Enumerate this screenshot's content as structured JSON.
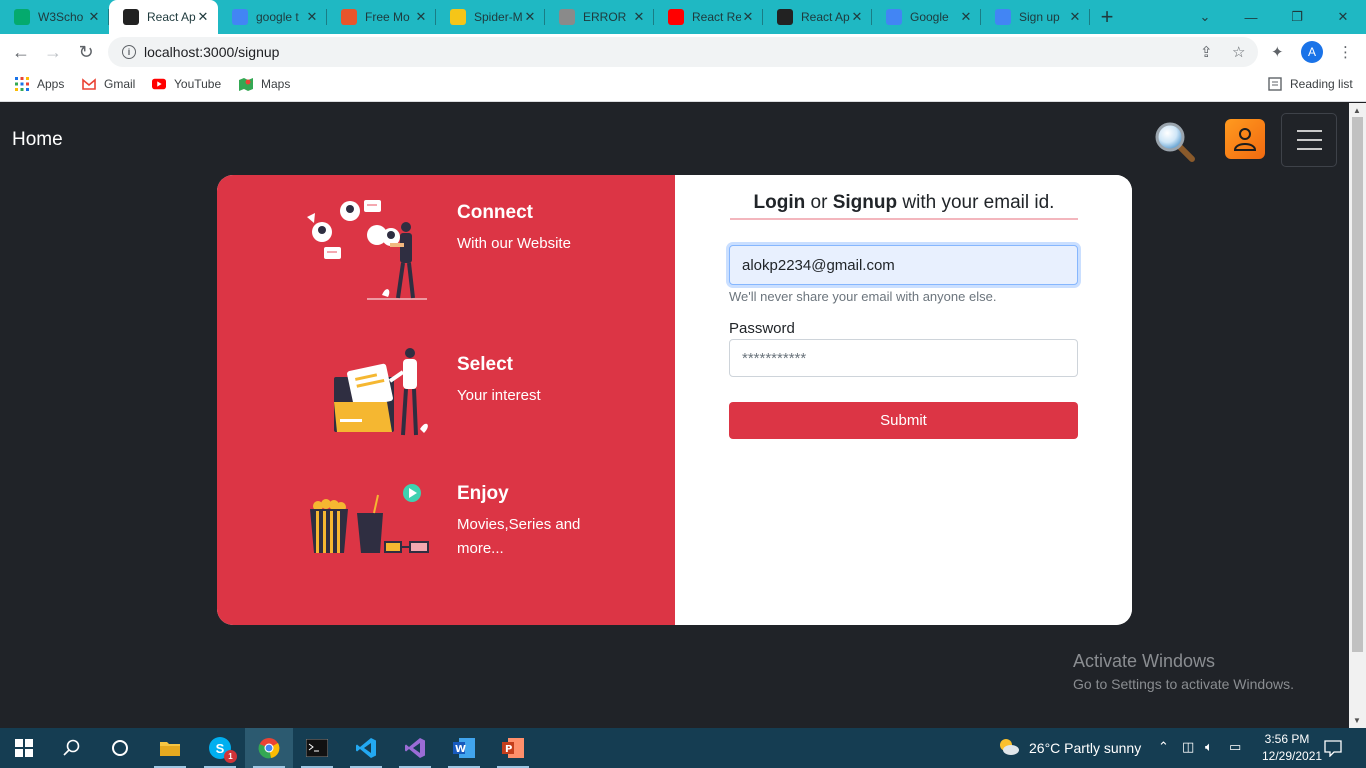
{
  "browser": {
    "tabs": [
      {
        "title": "W3Scho",
        "favicon": "w3schools-icon",
        "color": "#04aa6d"
      },
      {
        "title": "React Ap",
        "favicon": "react-icon",
        "color": "#222222",
        "active": true
      },
      {
        "title": "google t",
        "favicon": "google-icon",
        "color": "#4285f4"
      },
      {
        "title": "Free Mo",
        "favicon": "ae-icon",
        "color": "#e8552b"
      },
      {
        "title": "Spider-M",
        "favicon": "imdb-icon",
        "color": "#f5c518"
      },
      {
        "title": "ERROR",
        "favicon": "globe-icon",
        "color": "#8a8a8a"
      },
      {
        "title": "React Re",
        "favicon": "youtube-icon",
        "color": "#ff0000"
      },
      {
        "title": "React Ap",
        "favicon": "react-icon",
        "color": "#222222"
      },
      {
        "title": "Google",
        "favicon": "google-icon",
        "color": "#4285f4"
      },
      {
        "title": "Sign up",
        "favicon": "google-icon",
        "color": "#4285f4"
      }
    ],
    "url": "localhost:3000/signup",
    "profile_initial": "A",
    "bookmarks": [
      {
        "label": "Apps",
        "icon": "apps-grid-icon"
      },
      {
        "label": "Gmail",
        "icon": "gmail-icon"
      },
      {
        "label": "YouTube",
        "icon": "youtube-icon"
      },
      {
        "label": "Maps",
        "icon": "maps-icon"
      }
    ],
    "reading_list": "Reading list"
  },
  "navbar": {
    "brand": "Home"
  },
  "features": [
    {
      "title": "Connect",
      "subtitle": "With our Website"
    },
    {
      "title": "Select",
      "subtitle": "Your interest"
    },
    {
      "title": "Enjoy",
      "subtitle": "Movies,Series and more..."
    }
  ],
  "form": {
    "heading_login": "Login",
    "heading_or": " or ",
    "heading_signup": "Signup",
    "heading_rest": " with your email id.",
    "email_value": "alokp2234@gmail.com",
    "email_help": "We'll never share your email with anyone else.",
    "password_label": "Password",
    "password_value": "***********",
    "submit_label": "Submit"
  },
  "watermark": {
    "title": "Activate Windows",
    "subtitle": "Go to Settings to activate Windows."
  },
  "taskbar": {
    "weather": "26°C  Partly sunny",
    "time": "3:56 PM",
    "date": "12/29/2021",
    "skype_badge": "1"
  },
  "colors": {
    "accent": "#dc3545",
    "page_bg": "#202328",
    "tabstrip": "#1fb8c3",
    "taskbar": "#153d52"
  }
}
